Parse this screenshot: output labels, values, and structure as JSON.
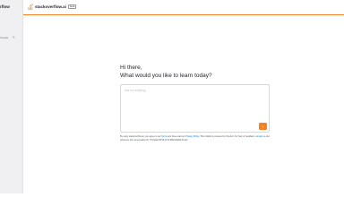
{
  "sidebar": {
    "brand": "rflow",
    "item": {
      "label": "hreads",
      "icon": "edit-icon"
    }
  },
  "header": {
    "logo_text": "stackoverflow.ai",
    "badge": "beta",
    "accent_color": "#f48225"
  },
  "greeting": {
    "line1": "Hi there,",
    "line2": "What would you like to learn today?"
  },
  "prompt": {
    "placeholder": "Ask me anything",
    "send_icon": "arrow-up-icon",
    "send_glyph": "↑"
  },
  "disclaimer": {
    "text1": "By using stackoverflow.ai, you agree to our ",
    "link_terms": "Terms",
    "text2": " and have read our ",
    "link_privacy": "Privacy Policy",
    "text3": ". This chatbot is powered by OpenAI. For help or feedback, ",
    "link_contact": "contact us",
    "text4": " and reference this conversation ID: 7f47a9e0-8769-47c6-8f82-8dd0b-37a14"
  }
}
